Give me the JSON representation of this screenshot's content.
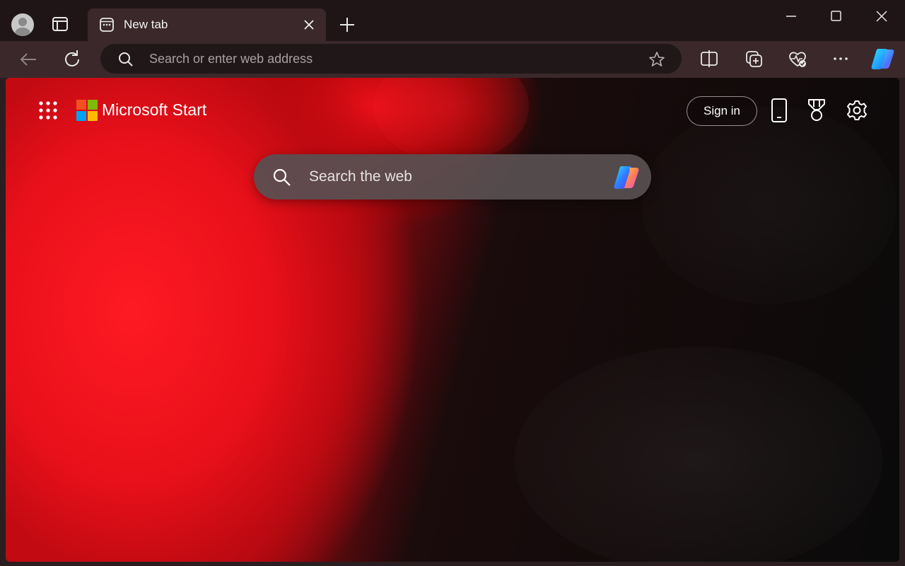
{
  "browser": {
    "tab_title": "New tab",
    "address_placeholder": "Search or enter web address",
    "icons": [
      "profile-icon",
      "tab-actions-icon",
      "new-tab-icon",
      "close-tab-icon",
      "minimize-icon",
      "maximize-icon",
      "close-window-icon",
      "back-icon",
      "refresh-icon",
      "search-icon",
      "favorite-star-icon",
      "split-screen-icon",
      "collections-icon",
      "browser-essentials-icon",
      "more-icon",
      "copilot-icon"
    ]
  },
  "start_page": {
    "brand": "Microsoft Start",
    "sign_in_label": "Sign in",
    "search_placeholder": "Search the web",
    "icons": [
      "app-launcher-icon",
      "microsoft-logo",
      "phone-icon",
      "rewards-icon",
      "settings-icon",
      "copilot-icon"
    ]
  },
  "colors": {
    "titlebar": "#1f1517",
    "toolbar": "#3a282b",
    "omnibox": "#201719",
    "wallpaper_red": "#e8101a",
    "wallpaper_black": "#0b0a0a"
  }
}
